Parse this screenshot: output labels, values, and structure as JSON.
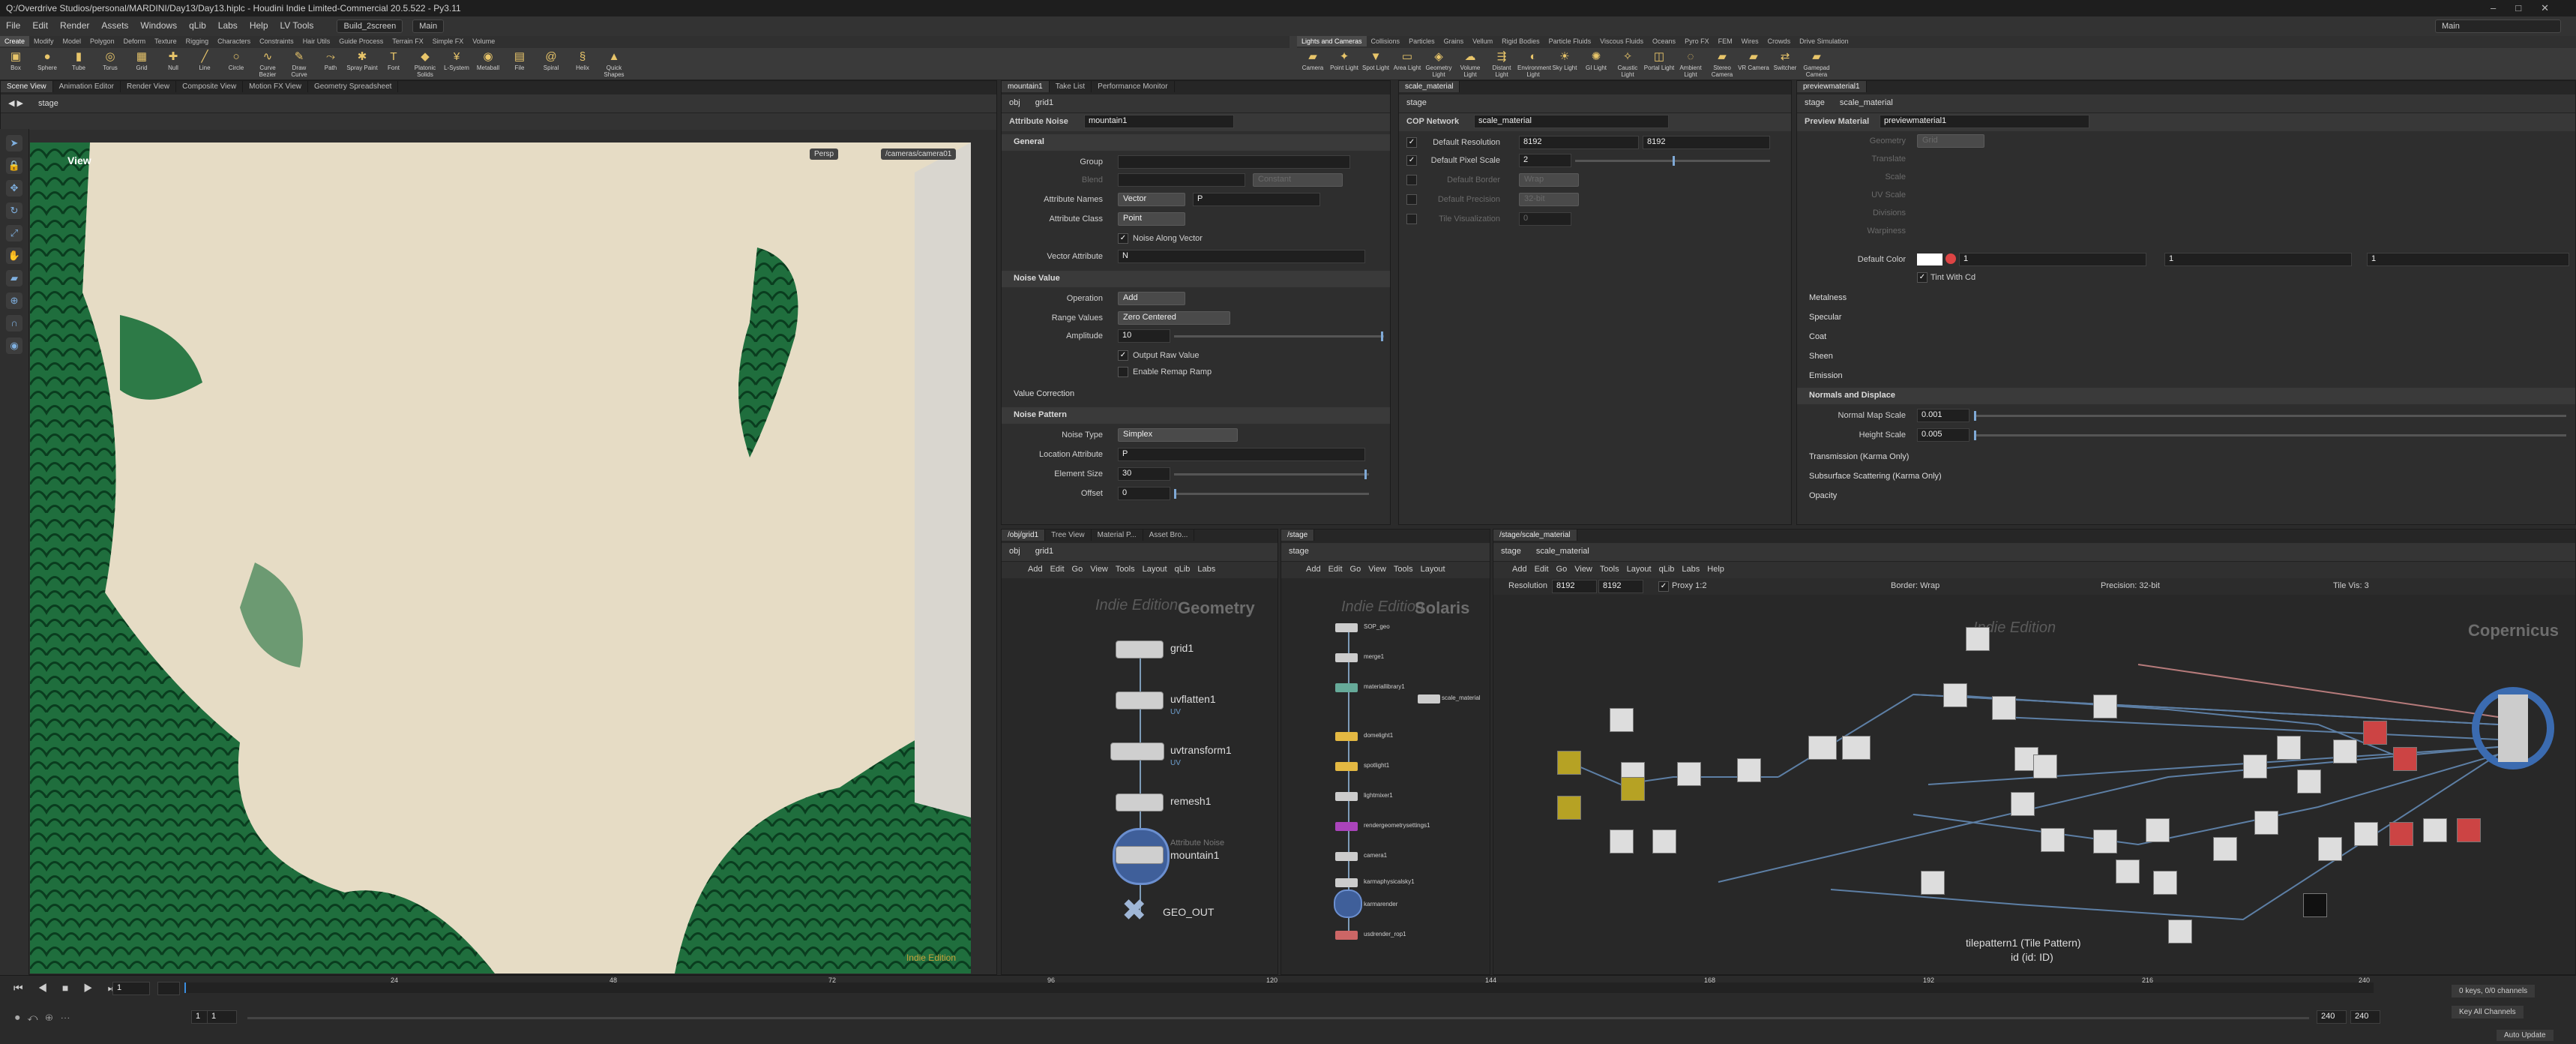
{
  "window": {
    "title": "Q:/Overdrive Studios/personal/MARDINI/Day13/Day13.hiplc - Houdini Indie Limited-Commercial 20.5.522 - Py3.11",
    "controls": [
      "–",
      "□",
      "✕"
    ]
  },
  "menubar": {
    "items": [
      "File",
      "Edit",
      "Render",
      "Assets",
      "Windows",
      "qLib",
      "Labs",
      "Help",
      "LV Tools"
    ],
    "desktop": "Build_2screen",
    "branch": "Main",
    "right_desktop": "Main"
  },
  "shelf": {
    "left_tabs": [
      "Create",
      "Modify",
      "Model",
      "Polygon",
      "Deform",
      "Texture",
      "Rigging",
      "Characters",
      "Constraints",
      "Hair Utils",
      "Guide Process",
      "Terrain FX",
      "Simple FX",
      "Volume"
    ],
    "left_tools": [
      "Box",
      "Sphere",
      "Tube",
      "Torus",
      "Grid",
      "Null",
      "Line",
      "Circle",
      "Curve Bezier",
      "Draw Curve",
      "Path",
      "Spray Paint",
      "Font",
      "Platonic Solids",
      "L-System",
      "Metaball",
      "File",
      "Spiral",
      "Helix",
      "Quick Shapes"
    ],
    "right_tabs": [
      "Lights and Cameras",
      "Collisions",
      "Particles",
      "Grains",
      "Vellum",
      "Rigid Bodies",
      "Particle Fluids",
      "Viscous Fluids",
      "Oceans",
      "Pyro FX",
      "FEM",
      "Wires",
      "Crowds",
      "Drive Simulation"
    ],
    "right_tools": [
      "Camera",
      "Point Light",
      "Spot Light",
      "Area Light",
      "Geometry Light",
      "Volume Light",
      "Distant Light",
      "Environment Light",
      "Sky Light",
      "GI Light",
      "Caustic Light",
      "Portal Light",
      "Ambient Light",
      "Stereo Camera",
      "VR Camera",
      "Switcher",
      "Gamepad Camera"
    ]
  },
  "scene_view": {
    "tabs": [
      "Scene View",
      "Animation Editor",
      "Render View",
      "Composite View",
      "Motion FX View",
      "Geometry Spreadsheet"
    ],
    "path": "stage",
    "view_label": "View",
    "persp": "Persp",
    "camera": "/cameras/camera01",
    "watermark": "Indie Edition"
  },
  "attr_noise": {
    "tabs": [
      "mountain1",
      "Take List",
      "Performance Monitor"
    ],
    "path": "obj",
    "path2": "grid1",
    "node_type": "Attribute Noise",
    "node_name": "mountain1",
    "sections": {
      "general": "General",
      "noise_value": "Noise Value",
      "value_correction": "Value Correction",
      "noise_pattern": "Noise Pattern"
    },
    "params": {
      "group_label": "Group",
      "blend_label": "Blend",
      "blend_mode": "Constant",
      "attr_names_label": "Attribute Names",
      "attr_names_type": "Vector",
      "attr_names_value": "P",
      "attr_class_label": "Attribute Class",
      "attr_class_value": "Point",
      "noise_along_vector": "Noise Along Vector",
      "vector_attr_label": "Vector Attribute",
      "vector_attr_value": "N",
      "operation_label": "Operation",
      "operation_value": "Add",
      "range_label": "Range Values",
      "range_value": "Zero Centered",
      "amplitude_label": "Amplitude",
      "amplitude_value": "10",
      "output_raw": "Output Raw Value",
      "enable_remap": "Enable Remap Ramp",
      "noise_type_label": "Noise Type",
      "noise_type_value": "Simplex",
      "location_attr_label": "Location Attribute",
      "location_attr_value": "P",
      "element_size_label": "Element Size",
      "element_size_value": "30",
      "offset_label": "Offset",
      "offset_value": "0"
    }
  },
  "cop_net": {
    "tabs": [
      "scale_material"
    ],
    "path": "stage",
    "node_type": "COP Network",
    "node_name": "scale_material",
    "params": {
      "res_label": "Default Resolution",
      "res_x": "8192",
      "res_y": "8192",
      "pixel_scale_label": "Default Pixel Scale",
      "pixel_scale_value": "2",
      "border_label": "Default Border",
      "border_value": "Wrap",
      "precision_label": "Default Precision",
      "precision_value": "32-bit",
      "tile_vis_label": "Tile Visualization",
      "tile_vis_value": "0"
    }
  },
  "preview_mat": {
    "tabs": [
      "previewmaterial1"
    ],
    "path": "stage",
    "path2": "scale_material",
    "node_type": "Preview Material",
    "node_name": "previewmaterial1",
    "params": {
      "geometry_label": "Geometry",
      "geometry_value": "Grid",
      "translate_label": "Translate",
      "scale_label": "Scale",
      "uv_scale_label": "UV Scale",
      "divisions_label": "Divisions",
      "warpiness_label": "Warpiness",
      "default_color_label": "Default Color",
      "color_r": "1",
      "color_g": "1",
      "color_b": "1",
      "tint_with_cd": "Tint With Cd"
    },
    "sections": [
      "Metalness",
      "Specular",
      "Coat",
      "Sheen",
      "Emission",
      "Normals and Displace",
      "Transmission (Karma Only)",
      "Subsurface Scattering (Karma Only)",
      "Opacity"
    ],
    "normal_map_label": "Normal Map Scale",
    "normal_map_value": "0.001",
    "height_scale_label": "Height Scale",
    "height_scale_value": "0.005"
  },
  "geo_net": {
    "tabs": [
      "/obj/grid1",
      "Tree View",
      "Material P...",
      "Asset Bro..."
    ],
    "path": "obj",
    "path2": "grid1",
    "menus": [
      "Add",
      "Edit",
      "Go",
      "View",
      "Tools",
      "Layout",
      "qLib",
      "Labs"
    ],
    "watermark": "Indie Edition",
    "context": "Geometry",
    "nodes": [
      {
        "name": "grid1",
        "sub": ""
      },
      {
        "name": "uvflatten1",
        "sub": "UV"
      },
      {
        "name": "uvtransform1",
        "sub": "UV"
      },
      {
        "name": "remesh1",
        "sub": ""
      },
      {
        "name": "mountain1",
        "sub": "Attribute Noise"
      },
      {
        "name": "GEO_OUT",
        "sub": ""
      }
    ]
  },
  "stage_net": {
    "tabs": [
      "/stage"
    ],
    "path": "stage",
    "menus": [
      "Add",
      "Edit",
      "Go",
      "View",
      "Tools",
      "Layout"
    ],
    "watermark": "Indie Edition",
    "context": "Solaris",
    "nodes": [
      "SOP_geo",
      "merge1",
      "materiallibrary1",
      "domelight1",
      "spotlight1",
      "lightmixer1",
      "rendergeometrysettings1",
      "camera1",
      "karmaphysicalsky1",
      "karmarender",
      "usdrender_rop1"
    ],
    "side_node": "scale_material"
  },
  "cop_editor": {
    "tabs": [
      "/stage/scale_material"
    ],
    "path": "stage",
    "path2": "scale_material",
    "menus": [
      "Add",
      "Edit",
      "Go",
      "View",
      "Tools",
      "Layout",
      "qLib",
      "Labs",
      "Help"
    ],
    "resolution_label": "Resolution",
    "res_x": "8192",
    "res_y": "8192",
    "proxy": "Proxy 1:2",
    "border": "Border: Wrap",
    "precision": "Precision: 32-bit",
    "tile_vis": "Tile Vis: 3",
    "watermark": "Indie Edition",
    "context": "Copernicus",
    "info_title": "tilepattern1 (Tile Pattern)",
    "info_id": "id (id: ID)"
  },
  "timeline": {
    "current_frame": "1",
    "start": "1",
    "start2": "1",
    "end": "240",
    "end2": "240",
    "ticks": [
      "24",
      "48",
      "72",
      "96",
      "120",
      "144",
      "168",
      "192",
      "216",
      "240"
    ],
    "keys": "0 keys, 0/0 channels",
    "key_all": "Key All Channels",
    "auto_update": "Auto Update"
  }
}
